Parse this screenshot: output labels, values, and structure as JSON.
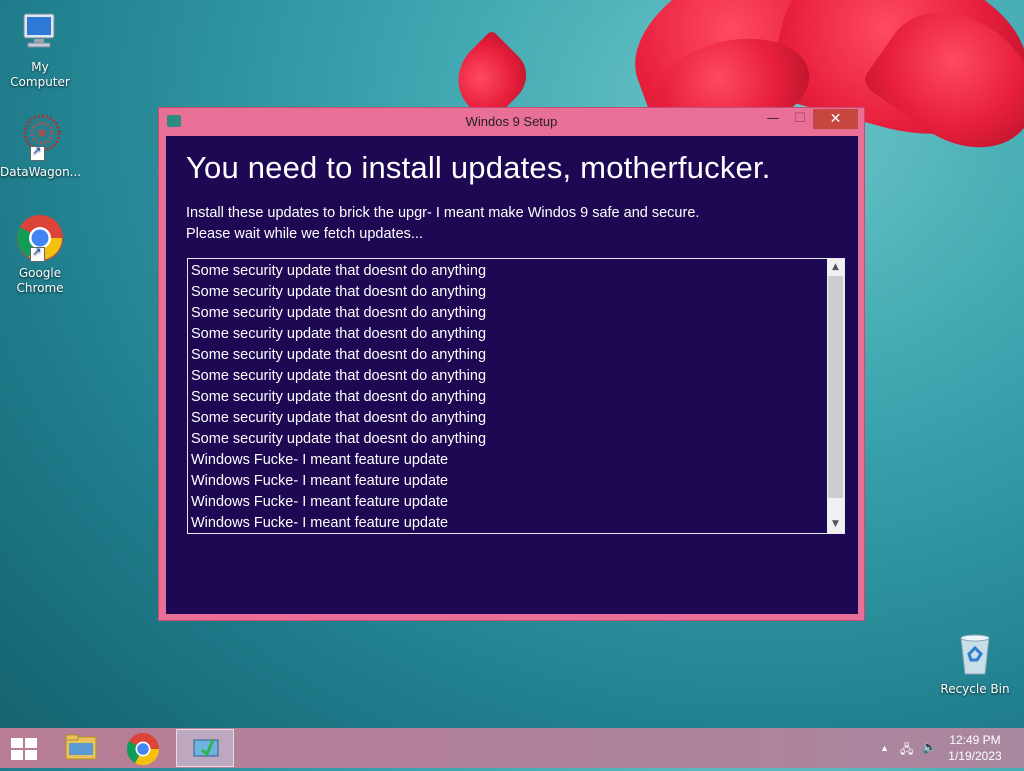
{
  "desktop": {
    "icons": [
      {
        "label": "My Computer"
      },
      {
        "label": "DataWagon..."
      },
      {
        "label": "Google Chrome"
      },
      {
        "label": "Recycle Bin"
      }
    ]
  },
  "window": {
    "title": "Windos 9 Setup",
    "controls": {
      "minimize": "—",
      "maximize": "☐",
      "close": "✕"
    },
    "heading": "You need to install updates, motherfucker.",
    "subtext_line1": "Install these updates to brick the upgr- I meant make Windos 9 safe and secure.",
    "subtext_line2": "Please wait while we fetch updates...",
    "updates": [
      "Some security update that doesnt do anything",
      "Some security update that doesnt do anything",
      "Some security update that doesnt do anything",
      "Some security update that doesnt do anything",
      "Some security update that doesnt do anything",
      "Some security update that doesnt do anything",
      "Some security update that doesnt do anything",
      "Some security update that doesnt do anything",
      "Some security update that doesnt do anything",
      "Windows Fucke- I meant feature update",
      "Windows Fucke- I meant feature update",
      "Windows Fucke- I meant feature update",
      "Windows Fucke- I meant feature update"
    ]
  },
  "taskbar": {
    "time": "12:49 PM",
    "date": "1/19/2023"
  },
  "colors": {
    "window_frame": "#ea6f96",
    "client_bg": "#1e0853",
    "close_button": "#c7463f"
  }
}
